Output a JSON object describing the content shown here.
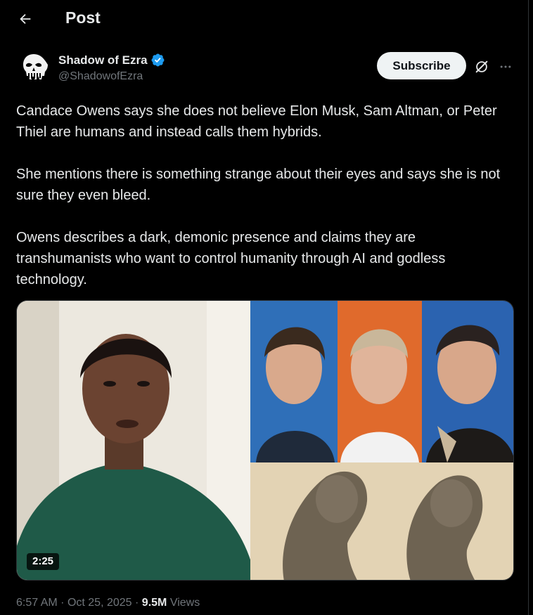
{
  "header": {
    "title": "Post",
    "back_icon": "back-arrow-icon"
  },
  "author": {
    "display_name": "Shadow of Ezra",
    "handle": "@ShadowofEzra",
    "verified": true,
    "verified_color": "#1d9bf0",
    "avatar_icon": "punisher-skull-icon"
  },
  "actions": {
    "subscribe_label": "Subscribe",
    "grok_icon": "grok-icon",
    "more_icon": "more-dots-icon"
  },
  "tweet": {
    "paragraphs": [
      "Candace Owens says she does not believe Elon Musk, Sam Altman, or Peter Thiel are humans and instead calls them hybrids.",
      "She mentions there is something strange about their eyes and says she is not sure they even bleed.",
      "Owens describes a dark, demonic presence and claims they are transhumanists who want to control humanity through AI and godless technology."
    ]
  },
  "media": {
    "duration": "2:25"
  },
  "meta": {
    "time": "6:57 AM",
    "date": "Oct 25, 2025",
    "separator": "·",
    "views_count": "9.5M",
    "views_label": "Views"
  }
}
